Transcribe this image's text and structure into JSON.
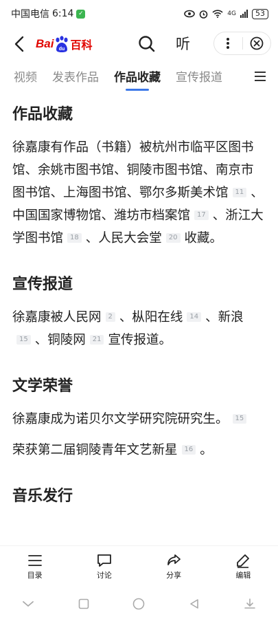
{
  "status_bar": {
    "carrier": "中国电信",
    "time": "6:14",
    "network": "4G",
    "battery": "53"
  },
  "header": {
    "logo_bai": "Bai",
    "logo_du": "du",
    "logo_baike": "百科",
    "listen_label": "听",
    "more_label": "⋮"
  },
  "tabs": [
    {
      "label": "视频"
    },
    {
      "label": "发表作品"
    },
    {
      "label": "作品收藏"
    },
    {
      "label": "宣传报道"
    }
  ],
  "sections": {
    "collection": {
      "title": "作品收藏",
      "p1": "徐嘉康有作品（书籍）被杭州市临平区图书馆、余姚市图书馆、铜陵市图书馆、南京市图书馆、上海图书馆、鄂尔多斯美术馆",
      "ref1": "11",
      "p2": "、中国国家博物馆、潍坊市档案馆",
      "ref2": "17",
      "p3": "、浙江大学图书馆",
      "ref3": "18",
      "p4": "、人民大会堂",
      "ref4": "20",
      "p5": "收藏。"
    },
    "publicity": {
      "title": "宣传报道",
      "p1": "徐嘉康被人民网",
      "ref1": "2",
      "p2": "、枞阳在线",
      "ref2": "14",
      "p3": "、新浪",
      "ref3": "15",
      "p4": "、铜陵网",
      "ref4": "21",
      "p5": "宣传报道。"
    },
    "honors": {
      "title": "文学荣誉",
      "p1": "徐嘉康成为诺贝尔文学研究院研究生。",
      "ref1": "15",
      "p2": "荣获第二届铜陵青年文艺新星",
      "ref2": "16",
      "p3": "。"
    },
    "music": {
      "title": "音乐发行"
    }
  },
  "bottom_bar": {
    "toc": "目录",
    "discuss": "讨论",
    "share": "分享",
    "edit": "编辑"
  }
}
